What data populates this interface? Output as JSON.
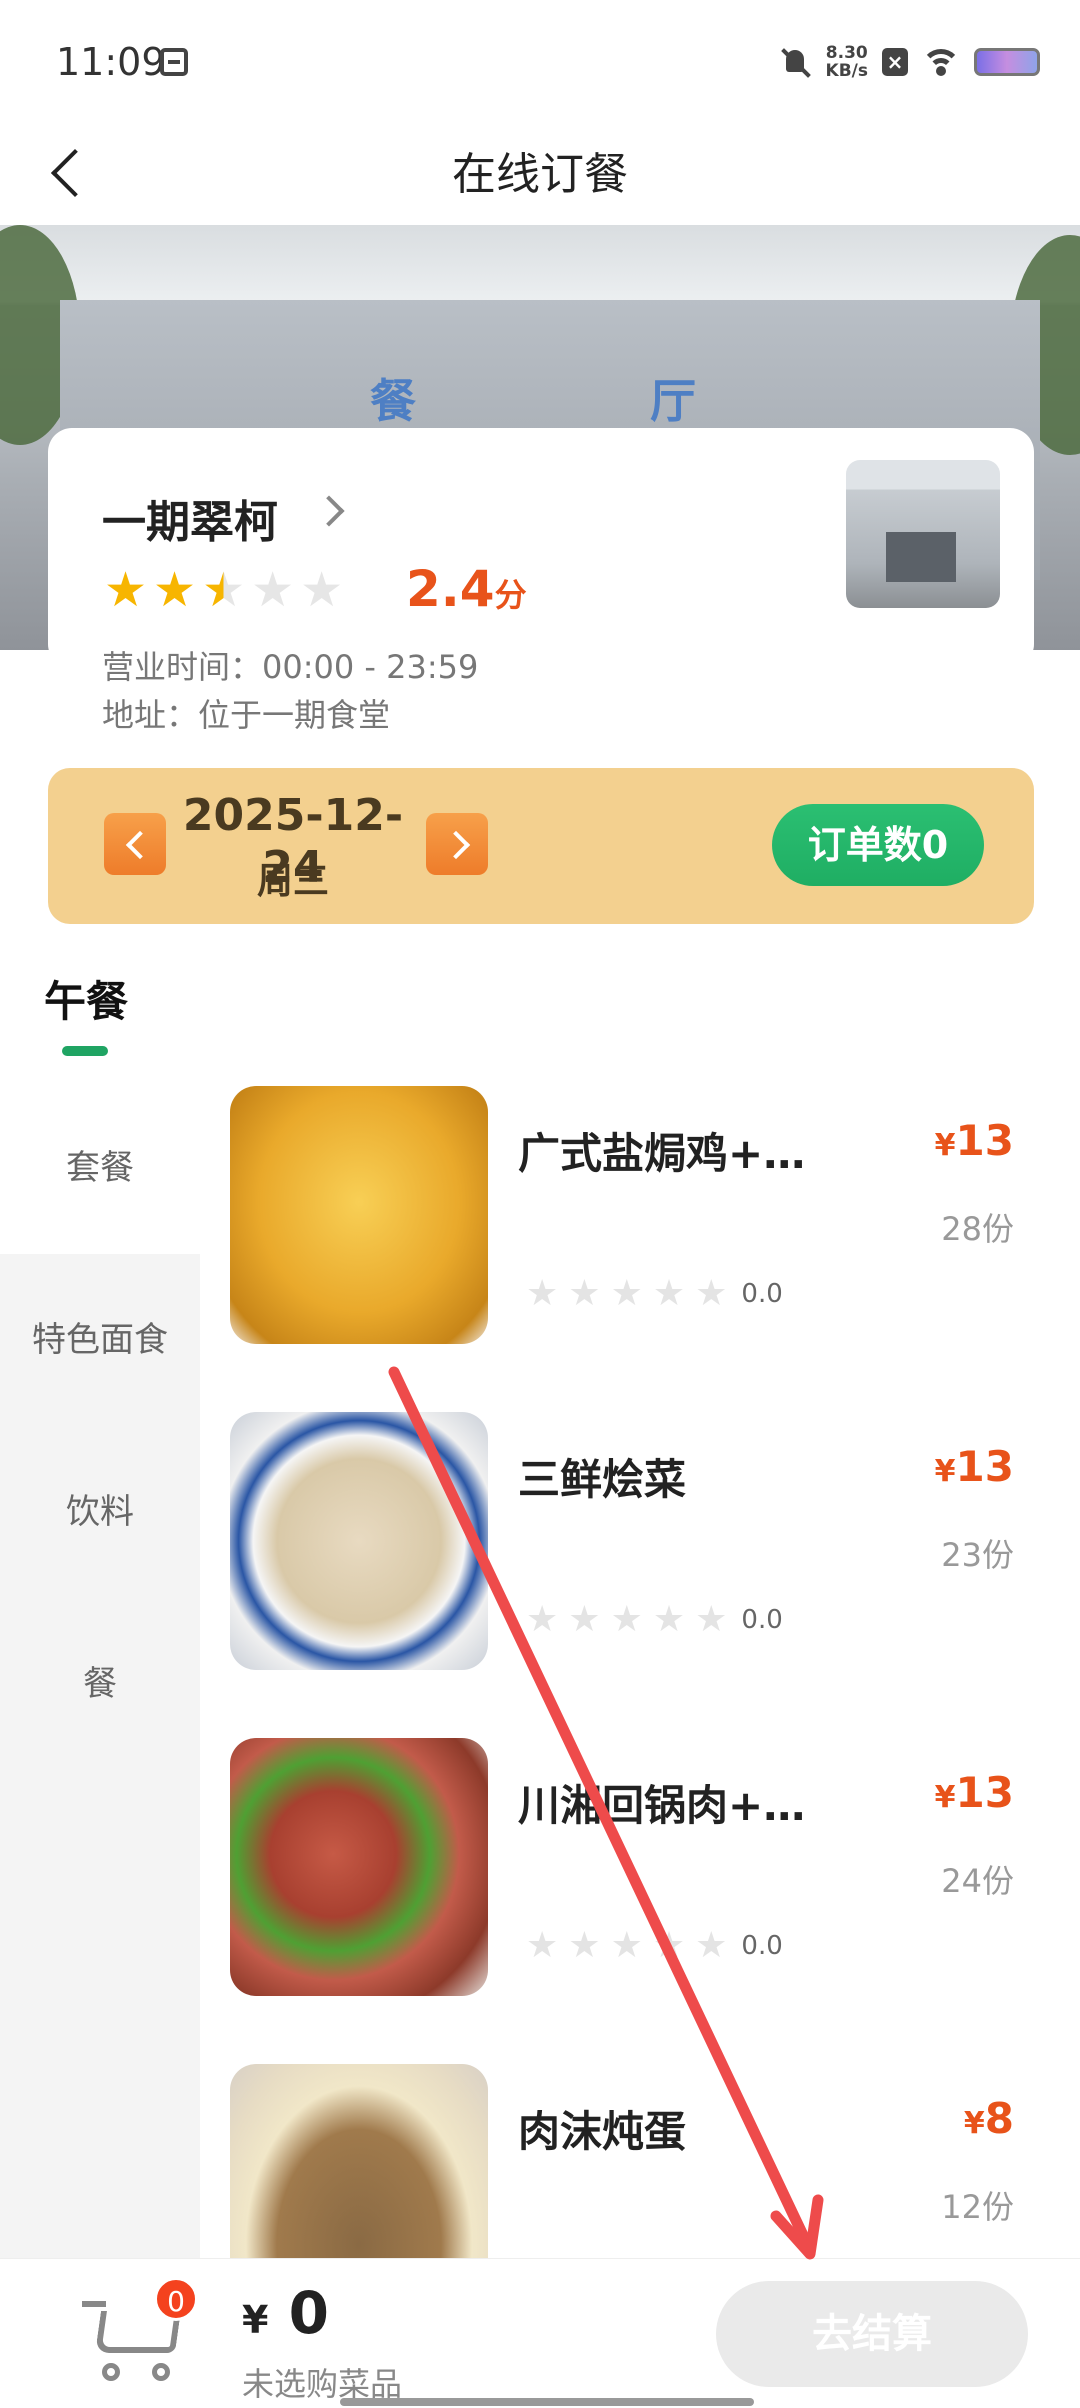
{
  "status_bar": {
    "time": "11:09",
    "net_speed_value": "8.30",
    "net_speed_unit": "KB/s"
  },
  "header": {
    "title": "在线订餐"
  },
  "banner": {
    "sign_left": "餐",
    "sign_right": "厅"
  },
  "store": {
    "name": "一期翠柯",
    "rating_value": "2.4",
    "rating_unit": "分",
    "rating_stars": 2.5,
    "hours": "营业时间：00:00 - 23:59",
    "address": "地址：位于一期食堂"
  },
  "date_bar": {
    "date": "2025-12-24",
    "weekday": "周三",
    "orders_label": "订单数0"
  },
  "meal_tab": {
    "label": "午餐"
  },
  "side_menu": [
    {
      "label": "套餐"
    },
    {
      "label": "特色面食"
    },
    {
      "label": "饮料"
    },
    {
      "label": "餐"
    }
  ],
  "dishes": [
    {
      "name": "广式盐焗鸡+…",
      "currency": "¥",
      "price": "13",
      "stock": "28份",
      "rating": "0.0"
    },
    {
      "name": "三鲜烩菜",
      "currency": "¥",
      "price": "13",
      "stock": "23份",
      "rating": "0.0"
    },
    {
      "name": "川湘回锅肉+…",
      "currency": "¥",
      "price": "13",
      "stock": "24份",
      "rating": "0.0"
    },
    {
      "name": "肉沫炖蛋",
      "currency": "¥",
      "price": "8",
      "stock": "12份",
      "rating": ""
    }
  ],
  "cart": {
    "badge": "0",
    "currency": "¥",
    "total": "0",
    "hint": "未选购菜品",
    "checkout_label": "去结算"
  },
  "colors": {
    "accent_orange": "#e8531a",
    "green": "#1fae63",
    "date_bar_bg": "#f3d08f",
    "star": "#f7b500",
    "annotation_arrow": "#ee4b4b"
  }
}
